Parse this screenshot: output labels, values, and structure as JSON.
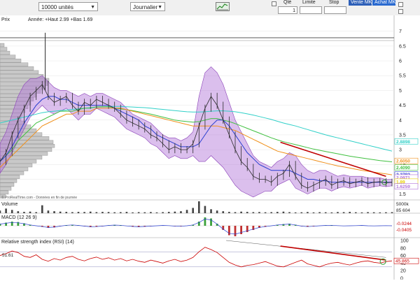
{
  "toolbar": {
    "quantity_select": "10000 unités",
    "period_select": "Journalier",
    "chart_type_icon": "chart-type-icon",
    "qty_label": "Qté",
    "qty_value": "1",
    "limit_label": "Limite",
    "stop_label": "Stop",
    "sell_button": "Vente MKT",
    "buy_button": "Achat MKT"
  },
  "colors": {
    "price": "#2a2a2a",
    "bollinger_fill": "#b070d8",
    "ma_blue": "#2a3fd0",
    "ma_orange": "#f0901a",
    "ma_green": "#40c040",
    "ma_red": "#e03020",
    "ma_cyan": "#30d0c8",
    "trendline": "#c00000",
    "rsi": "#cc0000"
  },
  "chart_data": {
    "type": "line",
    "price_panel": {
      "title": "Prix",
      "header": "Année: +Haut 2.99 +Bas 1.69",
      "ylim": [
        1.35,
        7.3
      ],
      "yticks": [
        "7",
        "6.5",
        "6",
        "5.5",
        "5",
        "4.5",
        "4",
        "3.5",
        "3",
        "2.5",
        "2",
        "1.5"
      ],
      "x": [
        0,
        4,
        8,
        12,
        16,
        20,
        24,
        28,
        32,
        36,
        40,
        44,
        48,
        52,
        56,
        60,
        64,
        68,
        72,
        76,
        80,
        84,
        88,
        92,
        96,
        100,
        104,
        108,
        112,
        116,
        120,
        124,
        128,
        132,
        136,
        140,
        144,
        148,
        152,
        156,
        160,
        164,
        168,
        172,
        176,
        180,
        184,
        188,
        192,
        196,
        200,
        204,
        208,
        212,
        216,
        220,
        224,
        228,
        232,
        236,
        240,
        244,
        248,
        252,
        256,
        260
      ],
      "close": [
        2.6,
        2.9,
        3.5,
        4.0,
        4.4,
        4.8,
        5.0,
        5.2,
        4.8,
        4.6,
        4.7,
        4.8,
        4.5,
        4.3,
        4.6,
        4.5,
        4.7,
        4.6,
        4.5,
        4.4,
        4.2,
        4.0,
        3.9,
        3.8,
        3.7,
        3.5,
        3.4,
        3.2,
        3.0,
        3.1,
        3.0,
        3.0,
        3.2,
        3.8,
        4.4,
        4.8,
        4.5,
        4.0,
        3.5,
        3.0,
        2.6,
        2.4,
        2.1,
        2.0,
        2.0,
        1.9,
        2.1,
        2.2,
        2.5,
        2.1,
        1.8,
        1.7,
        1.8,
        1.9,
        2.0,
        1.8,
        1.9,
        1.95,
        1.85,
        1.9,
        1.95,
        1.85,
        1.9,
        1.92,
        1.88,
        1.9
      ],
      "spike": {
        "x": 30,
        "high": 6.95
      },
      "bollinger_upper": [
        3.2,
        3.6,
        4.2,
        4.8,
        5.2,
        5.4,
        5.4,
        5.5,
        5.3,
        5.1,
        5.0,
        5.0,
        4.9,
        4.8,
        4.9,
        4.8,
        4.9,
        4.9,
        4.8,
        4.7,
        4.6,
        4.4,
        4.2,
        4.1,
        4.0,
        3.9,
        3.7,
        3.5,
        3.4,
        3.4,
        3.3,
        3.4,
        3.6,
        4.8,
        5.6,
        5.8,
        5.6,
        5.2,
        4.6,
        4.0,
        3.6,
        3.2,
        2.8,
        2.6,
        2.5,
        2.4,
        2.6,
        2.7,
        2.9,
        2.8,
        2.5,
        2.3,
        2.2,
        2.3,
        2.3,
        2.2,
        2.1,
        2.15,
        2.1,
        2.1,
        2.1,
        2.05,
        2.05,
        2.05,
        2.0,
        2.0
      ],
      "bollinger_lower": [
        2.2,
        2.5,
        2.9,
        3.3,
        3.7,
        4.1,
        4.3,
        4.5,
        4.3,
        4.2,
        4.3,
        4.4,
        4.2,
        4.0,
        4.2,
        4.2,
        4.4,
        4.3,
        4.2,
        4.1,
        3.9,
        3.7,
        3.6,
        3.5,
        3.4,
        3.2,
        3.1,
        2.9,
        2.7,
        2.8,
        2.7,
        2.7,
        2.8,
        2.6,
        2.6,
        2.8,
        2.6,
        2.4,
        2.1,
        1.8,
        1.6,
        1.5,
        1.4,
        1.5,
        1.6,
        1.6,
        1.8,
        1.9,
        2.0,
        1.7,
        1.6,
        1.5,
        1.6,
        1.7,
        1.7,
        1.6,
        1.7,
        1.75,
        1.7,
        1.75,
        1.8,
        1.7,
        1.75,
        1.78,
        1.75,
        1.78
      ],
      "ma_blue": [
        2.6,
        2.8,
        3.1,
        3.5,
        3.9,
        4.2,
        4.5,
        4.7,
        4.8,
        4.8,
        4.7,
        4.7,
        4.6,
        4.5,
        4.5,
        4.5,
        4.5,
        4.5,
        4.5,
        4.4,
        4.3,
        4.2,
        4.1,
        4.0,
        3.8,
        3.7,
        3.5,
        3.4,
        3.3,
        3.2,
        3.1,
        3.1,
        3.1,
        3.2,
        3.5,
        3.8,
        4.0,
        4.0,
        3.8,
        3.5,
        3.2,
        2.9,
        2.7,
        2.5,
        2.4,
        2.3,
        2.3,
        2.3,
        2.3,
        2.2,
        2.1,
        2.0,
        2.0,
        1.95,
        1.95,
        1.9,
        1.9,
        1.9,
        1.9,
        1.9,
        1.9,
        1.9,
        1.9,
        1.9,
        1.9,
        1.9
      ],
      "ma_orange": [
        2.4,
        2.6,
        2.8,
        3.0,
        3.2,
        3.4,
        3.6,
        3.8,
        3.9,
        4.0,
        4.1,
        4.2,
        4.2,
        4.3,
        4.3,
        4.3,
        4.4,
        4.4,
        4.4,
        4.4,
        4.4,
        4.35,
        4.3,
        4.25,
        4.2,
        4.15,
        4.1,
        4.05,
        4.0,
        3.95,
        3.9,
        3.85,
        3.8,
        3.8,
        3.8,
        3.8,
        3.8,
        3.75,
        3.7,
        3.65,
        3.55,
        3.45,
        3.35,
        3.25,
        3.15,
        3.05,
        2.95,
        2.9,
        2.85,
        2.8,
        2.75,
        2.7,
        2.65,
        2.6,
        2.55,
        2.5,
        2.45,
        2.42,
        2.38,
        2.34,
        2.3,
        2.27,
        2.24,
        2.21,
        2.18,
        2.15
      ],
      "ma_green": [
        2.6,
        2.8,
        3.0,
        3.3,
        3.5,
        3.7,
        3.9,
        4.0,
        4.1,
        4.2,
        4.3,
        4.3,
        4.3,
        4.35,
        4.4,
        4.4,
        4.45,
        4.45,
        4.45,
        4.4,
        4.38,
        4.35,
        4.32,
        4.28,
        4.24,
        4.2,
        4.15,
        4.1,
        4.05,
        4.0,
        3.97,
        3.95,
        3.93,
        3.95,
        4.0,
        4.05,
        4.05,
        4.0,
        3.95,
        3.88,
        3.8,
        3.72,
        3.64,
        3.56,
        3.48,
        3.4,
        3.33,
        3.27,
        3.22,
        3.17,
        3.12,
        3.07,
        3.02,
        2.98,
        2.94,
        2.9,
        2.86,
        2.82,
        2.78,
        2.75,
        2.72,
        2.69,
        2.66,
        2.63,
        2.61,
        2.59
      ],
      "ma_cyan": [
        3.9,
        3.95,
        4.0,
        4.05,
        4.1,
        4.15,
        4.2,
        4.25,
        4.28,
        4.3,
        4.32,
        4.34,
        4.36,
        4.38,
        4.4,
        4.42,
        4.44,
        4.45,
        4.46,
        4.46,
        4.46,
        4.45,
        4.44,
        4.43,
        4.42,
        4.4,
        4.38,
        4.36,
        4.34,
        4.32,
        4.3,
        4.28,
        4.27,
        4.27,
        4.28,
        4.3,
        4.31,
        4.31,
        4.3,
        4.28,
        4.25,
        4.21,
        4.17,
        4.12,
        4.07,
        4.02,
        3.96,
        3.9,
        3.85,
        3.8,
        3.74,
        3.68,
        3.62,
        3.56,
        3.5,
        3.45,
        3.4,
        3.35,
        3.3,
        3.25,
        3.2,
        3.15,
        3.1,
        3.05,
        3.0,
        2.95
      ],
      "trendline": {
        "x": [
          186,
          256
        ],
        "y": [
          3.25,
          2.1
        ]
      },
      "right_labels": [
        {
          "text": "2.8898",
          "y": 3.28,
          "color": "#30d0c8"
        },
        {
          "text": "2.6050",
          "y": 2.62,
          "color": "#f0901a"
        },
        {
          "text": "2.4090",
          "y": 2.4,
          "color": "#40c040"
        },
        {
          "text": "2.2782",
          "y": 2.16,
          "color": "#2a3fd0"
        },
        {
          "text": "2.0971",
          "y": 2.06,
          "color": "#b070d8"
        },
        {
          "text": "1.89",
          "y": 1.92,
          "color": "#e8d000"
        },
        {
          "text": "1.6259",
          "y": 1.76,
          "color": "#b070d8"
        }
      ],
      "watermark": "© ProRealTime.com - Données en fin de journée"
    },
    "volume_panel": {
      "title": "Volume",
      "right_labels": [
        "5000k",
        "85 604"
      ],
      "values": [
        20,
        35,
        25,
        15,
        10,
        12,
        8,
        60,
        20,
        15,
        12,
        10,
        8,
        10,
        9,
        12,
        8,
        10,
        9,
        7,
        8,
        10,
        6,
        8,
        7,
        9,
        6,
        8,
        10,
        12,
        15,
        25,
        40,
        90,
        55,
        30,
        20,
        15,
        10,
        8,
        12,
        10,
        8,
        9,
        7,
        8,
        10,
        12,
        8,
        6,
        7,
        9,
        6,
        8,
        7,
        6,
        9,
        8,
        10,
        7,
        6,
        8,
        7,
        6,
        7,
        8
      ]
    },
    "macd_panel": {
      "title": "MACD (12 26 9)",
      "right_labels": [
        "-0.0244",
        "-0.0405"
      ],
      "values": [
        0.1,
        0.15,
        0.2,
        0.18,
        0.12,
        0.05,
        0.0,
        -0.05,
        -0.1,
        -0.08,
        -0.02,
        0.03,
        0.05,
        0.02,
        -0.02,
        -0.06,
        -0.05,
        -0.02,
        0.02,
        0.04,
        0.03,
        -0.01,
        -0.04,
        -0.06,
        -0.04,
        -0.02,
        0.0,
        0.02,
        0.01,
        -0.02,
        -0.03,
        0.0,
        0.05,
        0.2,
        0.4,
        0.35,
        0.1,
        -0.2,
        -0.45,
        -0.5,
        -0.4,
        -0.3,
        -0.2,
        -0.1,
        -0.05,
        0.0,
        0.05,
        0.08,
        0.1,
        0.05,
        -0.02,
        -0.05,
        -0.03,
        0.0,
        0.02,
        0.03,
        0.01,
        -0.01,
        0.0,
        0.01,
        0.02,
        0.0,
        -0.01,
        0.0,
        0.01,
        0.0
      ]
    },
    "rsi_panel": {
      "title": "Relative strength index (RSI) (14)",
      "ylim": [
        0,
        100
      ],
      "yticks": [
        "100",
        "80",
        "60",
        "40",
        "20",
        "0"
      ],
      "left_label": "51.61",
      "right_label": "45.865",
      "levels": [
        70,
        30
      ],
      "values": [
        60,
        65,
        72,
        68,
        58,
        55,
        62,
        50,
        45,
        52,
        48,
        55,
        58,
        50,
        46,
        52,
        56,
        50,
        54,
        48,
        52,
        46,
        50,
        45,
        42,
        48,
        44,
        40,
        46,
        50,
        44,
        48,
        55,
        70,
        82,
        76,
        68,
        55,
        42,
        35,
        30,
        34,
        36,
        40,
        44,
        38,
        32,
        30,
        36,
        42,
        48,
        38,
        34,
        30,
        36,
        40,
        42,
        38,
        35,
        40,
        44,
        46,
        42,
        40,
        44,
        46
      ],
      "trendline": {
        "x": [
          186,
          256
        ],
        "y": [
          85,
          48
        ]
      },
      "faint_line": {
        "x": [
          150,
          256
        ],
        "y": [
          100,
          55
        ]
      }
    }
  }
}
